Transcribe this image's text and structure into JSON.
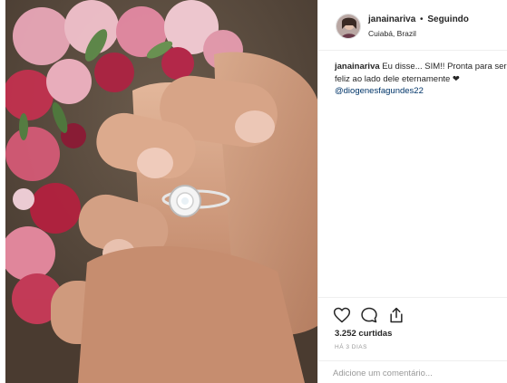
{
  "post": {
    "author": {
      "username": "janainariva",
      "separator": "•",
      "follow_status": "Seguindo",
      "location": "Cuiabá, Brazil"
    },
    "caption": {
      "username": "janainariva",
      "text": "Eu disse... SIM!! Pronta para ser feliz ao lado dele eternamente ❤",
      "mention": "@diogenesfagundes22"
    },
    "actions": {
      "icons": [
        "heart-icon",
        "comment-icon",
        "share-icon"
      ]
    },
    "likes": "3.252 curtidas",
    "timestamp": "HÁ 3 DIAS",
    "comment": {
      "placeholder": "Adicione um comentário..."
    }
  }
}
